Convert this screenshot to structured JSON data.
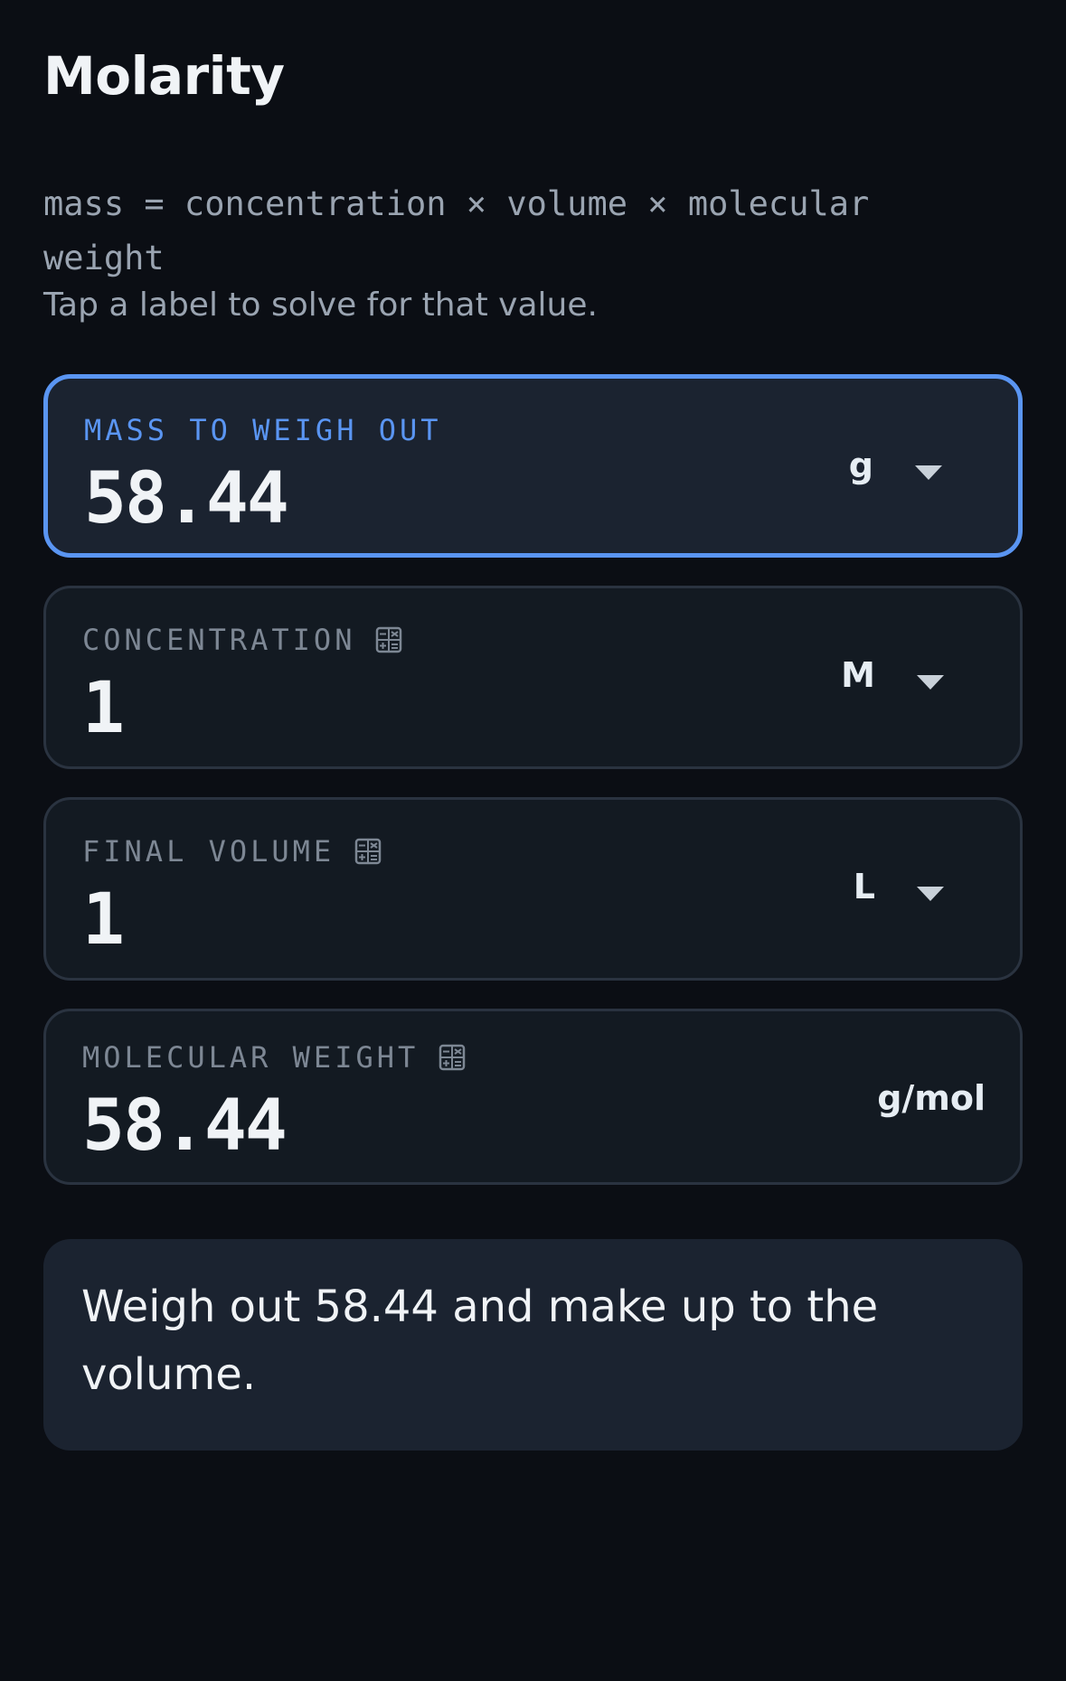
{
  "header": {
    "title": "Molarity",
    "formula": "mass = concentration × volume × molecular weight",
    "hint": "Tap a label to solve for that value."
  },
  "fields": {
    "mass": {
      "label": "MASS TO WEIGH OUT",
      "value": "58.44",
      "unit": "g",
      "active": true
    },
    "concentration": {
      "label": "CONCENTRATION",
      "value": "1",
      "unit": "M",
      "active": false
    },
    "volume": {
      "label": "FINAL VOLUME",
      "value": "1",
      "unit": "L",
      "active": false
    },
    "molecular_weight": {
      "label": "MOLECULAR WEIGHT",
      "value": "58.44",
      "unit": "g/mol",
      "active": false
    }
  },
  "result": {
    "text": "Weigh out 58.44 and make up to the volume."
  },
  "icons": {
    "calculator": "calculator-icon",
    "dropdown": "chevron-down-icon"
  },
  "colors": {
    "background": "#0b0e14",
    "card": "#131a22",
    "active_card": "#1b2330",
    "accent": "#5a95f2",
    "muted": "#7d8794"
  }
}
